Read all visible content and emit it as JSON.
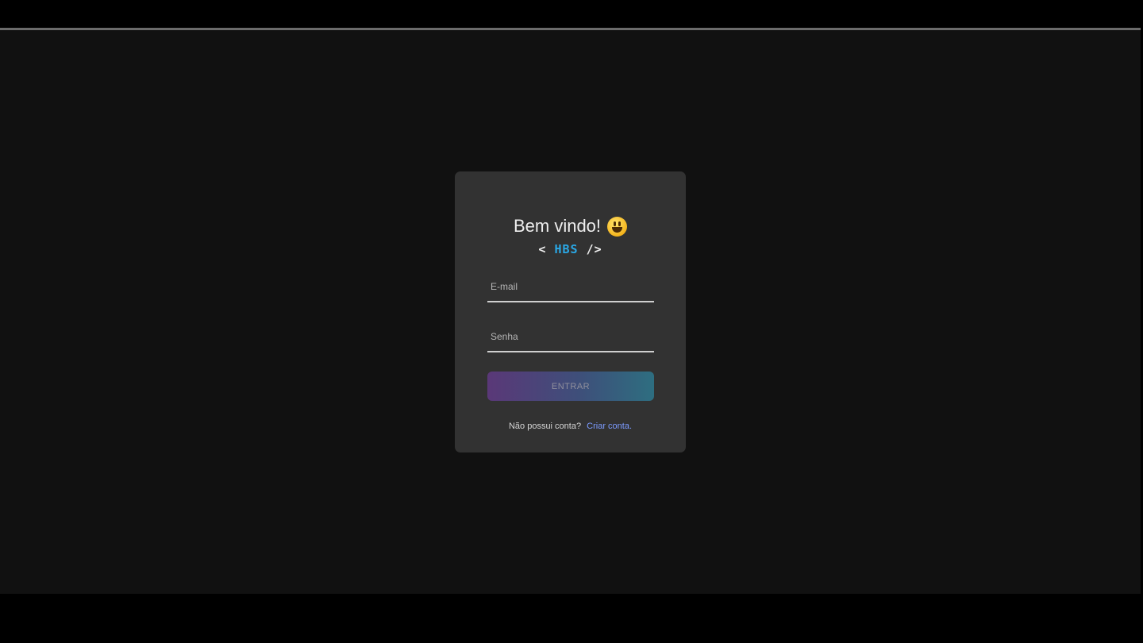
{
  "login": {
    "title": "Bem vindo!",
    "title_emoji": "smiley-face-icon",
    "logo": {
      "open": "<",
      "name": "HBS",
      "close": "/>"
    },
    "email": {
      "placeholder": "E-mail",
      "value": ""
    },
    "password": {
      "placeholder": "Senha",
      "value": ""
    },
    "submit_label": "ENTRAR",
    "signup_question": "Não possui conta?",
    "signup_link": "Criar conta."
  },
  "colors": {
    "page_background": "#111111",
    "card_background": "#323232",
    "logo_accent": "#2aa8e6",
    "link": "#7c9bff",
    "button_gradient_start": "#5a3878",
    "button_gradient_end": "#2e6e80"
  }
}
